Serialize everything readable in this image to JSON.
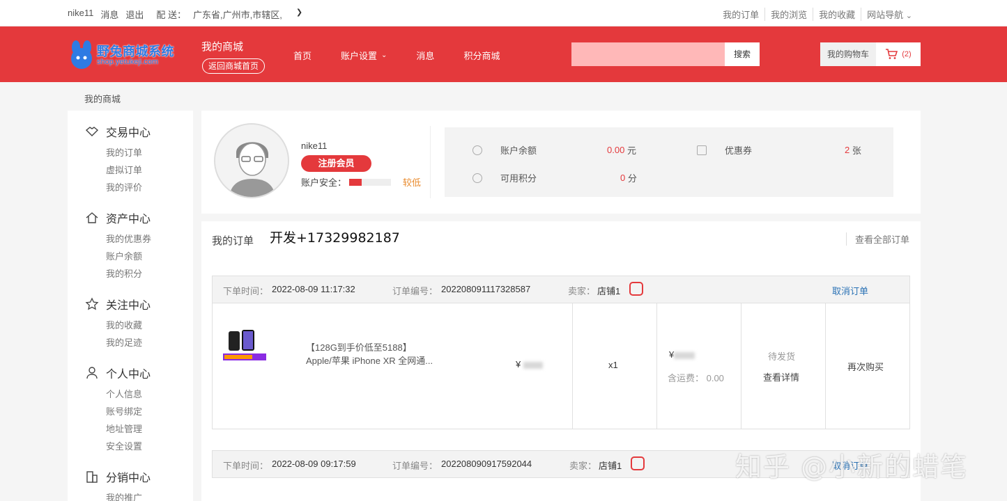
{
  "topbar": {
    "username": "nike11",
    "messages": "消息",
    "logout": "退出",
    "delivery_label": "配 送：",
    "delivery_location": "广东省,广州市,市辖区,",
    "links": [
      "我的订单",
      "我的浏览",
      "我的收藏",
      "网站导航"
    ]
  },
  "header": {
    "logo_title": "野兔商城系统",
    "logo_url": "shop.yetukeji.com",
    "my_mall": "我的商城",
    "back_home": "返回商城首页",
    "nav": [
      "首页",
      "账户设置",
      "消息",
      "积分商城"
    ],
    "search_placeholder": "",
    "search_button": "搜索",
    "cart_label": "我的购物车",
    "cart_count": "(2)"
  },
  "breadcrumb": "我的商城",
  "sidebar": {
    "sections": [
      {
        "title": "交易中心",
        "items": [
          "我的订单",
          "虚拟订单",
          "我的评价"
        ]
      },
      {
        "title": "资产中心",
        "items": [
          "我的优惠券",
          "账户余额",
          "我的积分"
        ]
      },
      {
        "title": "关注中心",
        "items": [
          "我的收藏",
          "我的足迹"
        ]
      },
      {
        "title": "个人中心",
        "items": [
          "个人信息",
          "账号绑定",
          "地址管理",
          "安全设置"
        ]
      },
      {
        "title": "分销中心",
        "items": [
          "我的推广"
        ]
      }
    ]
  },
  "profile": {
    "name": "nike11",
    "member_button": "注册会员",
    "safety_label": "账户安全：",
    "safety_level": "较低",
    "safety_fraction": 0.3,
    "balance_label": "账户余额",
    "balance_value": "0.00",
    "balance_unit": "元",
    "coupon_label": "优惠券",
    "coupon_value": "2",
    "coupon_unit": "张",
    "points_label": "可用积分",
    "points_value": "0",
    "points_unit": "分"
  },
  "orders": {
    "title": "我的订单",
    "dev_note": "开发+17329982187",
    "view_all": "查看全部订单",
    "list": [
      {
        "time_label": "下单时间：",
        "time": "2022-08-09 11:17:32",
        "no_label": "订单编号：",
        "no": "202208091117328587",
        "seller_label": "卖家：",
        "seller": "店铺1",
        "cancel": "取消订单",
        "product_line1": "【128G到手价低至5188】",
        "product_line2": "Apple/苹果 iPhone XR 全网通...",
        "price_symbol": "¥",
        "qty": "x1",
        "total_symbol": "¥",
        "shipping": "含运费： 0.00",
        "status": "待发货",
        "detail": "查看详情",
        "rebuy": "再次购买"
      },
      {
        "time_label": "下单时间：",
        "time": "2022-08-09 09:17:59",
        "no_label": "订单编号：",
        "no": "202208090917592044",
        "seller_label": "卖家：",
        "seller": "店铺1",
        "cancel": "取消订单"
      }
    ]
  },
  "watermark": "知乎 @小新的蜡笔"
}
